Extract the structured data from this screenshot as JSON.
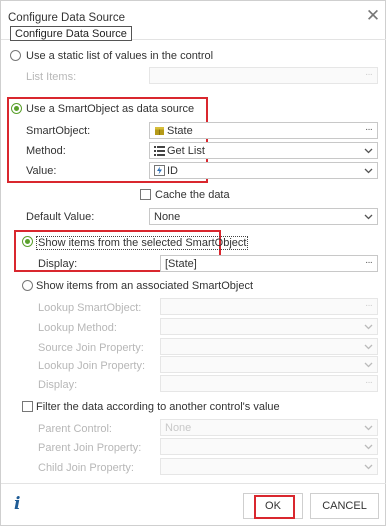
{
  "dialog": {
    "title": "Configure Data Source",
    "tooltip": "Configure Data Source"
  },
  "static_list": {
    "option_label": "Use a static list of values in the control",
    "list_items_label": "List Items:",
    "list_items_value": ""
  },
  "smartobject_source": {
    "option_label": "Use a SmartObject as data source",
    "smartobject_label": "SmartObject:",
    "smartobject_value": "State",
    "method_label": "Method:",
    "method_value": "Get List",
    "value_label": "Value:",
    "value_value": "ID"
  },
  "cache_label": "Cache the data",
  "default_value": {
    "label": "Default Value:",
    "value": "None"
  },
  "selected_items": {
    "option_label": "Show items from the selected SmartObject",
    "display_label": "Display:",
    "display_value": "[State]"
  },
  "associated_items": {
    "option_label": "Show items from an associated SmartObject",
    "lookup_smartobject_label": "Lookup SmartObject:",
    "lookup_method_label": "Lookup Method:",
    "source_join_label": "Source Join Property:",
    "lookup_join_label": "Lookup Join Property:",
    "display_label": "Display:"
  },
  "filter": {
    "option_label": "Filter the data according to another control's value",
    "parent_control_label": "Parent Control:",
    "parent_control_value": "None",
    "parent_join_label": "Parent Join Property:",
    "child_join_label": "Child Join Property:"
  },
  "buttons": {
    "ok": "OK",
    "cancel": "CANCEL"
  },
  "colors": {
    "accent": "#5aa02c",
    "highlight": "#d9272e",
    "info": "#1f5c95"
  }
}
